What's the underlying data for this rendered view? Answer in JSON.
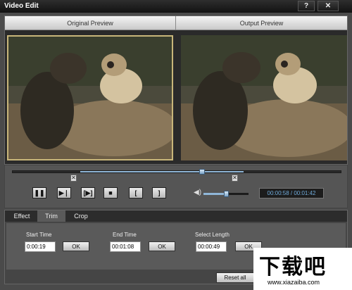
{
  "window": {
    "title": "Video Edit",
    "help_label": "?",
    "close_label": "✕"
  },
  "preview": {
    "original_label": "Original Preview",
    "output_label": "Output Preview"
  },
  "playback": {
    "buttons": {
      "pause": "❚❚",
      "step": "▶❘",
      "play_frame": "[▶]",
      "stop": "■",
      "mark_in": "[",
      "mark_out": "]"
    },
    "volume_icon": "speaker-icon",
    "volume_level": 0.45,
    "timecode": "00:00:58 / 00:01:42",
    "position_fraction": 0.58
  },
  "tabs": [
    "Effect",
    "Trim",
    "Crop"
  ],
  "trim": {
    "start_label": "Start Time",
    "start_value": "0:00:19",
    "end_label": "End Time",
    "end_value": "00:01:08",
    "length_label": "Select Length",
    "length_value": "00:00:49",
    "ok_label": "OK"
  },
  "reset_label": "Reset all",
  "watermark": {
    "text": "下载吧",
    "url": "www.xiazaiba.com"
  },
  "colors": {
    "accent": "#8fb6d8",
    "timecode": "#6fa9d8",
    "title_bg": "#121212"
  }
}
